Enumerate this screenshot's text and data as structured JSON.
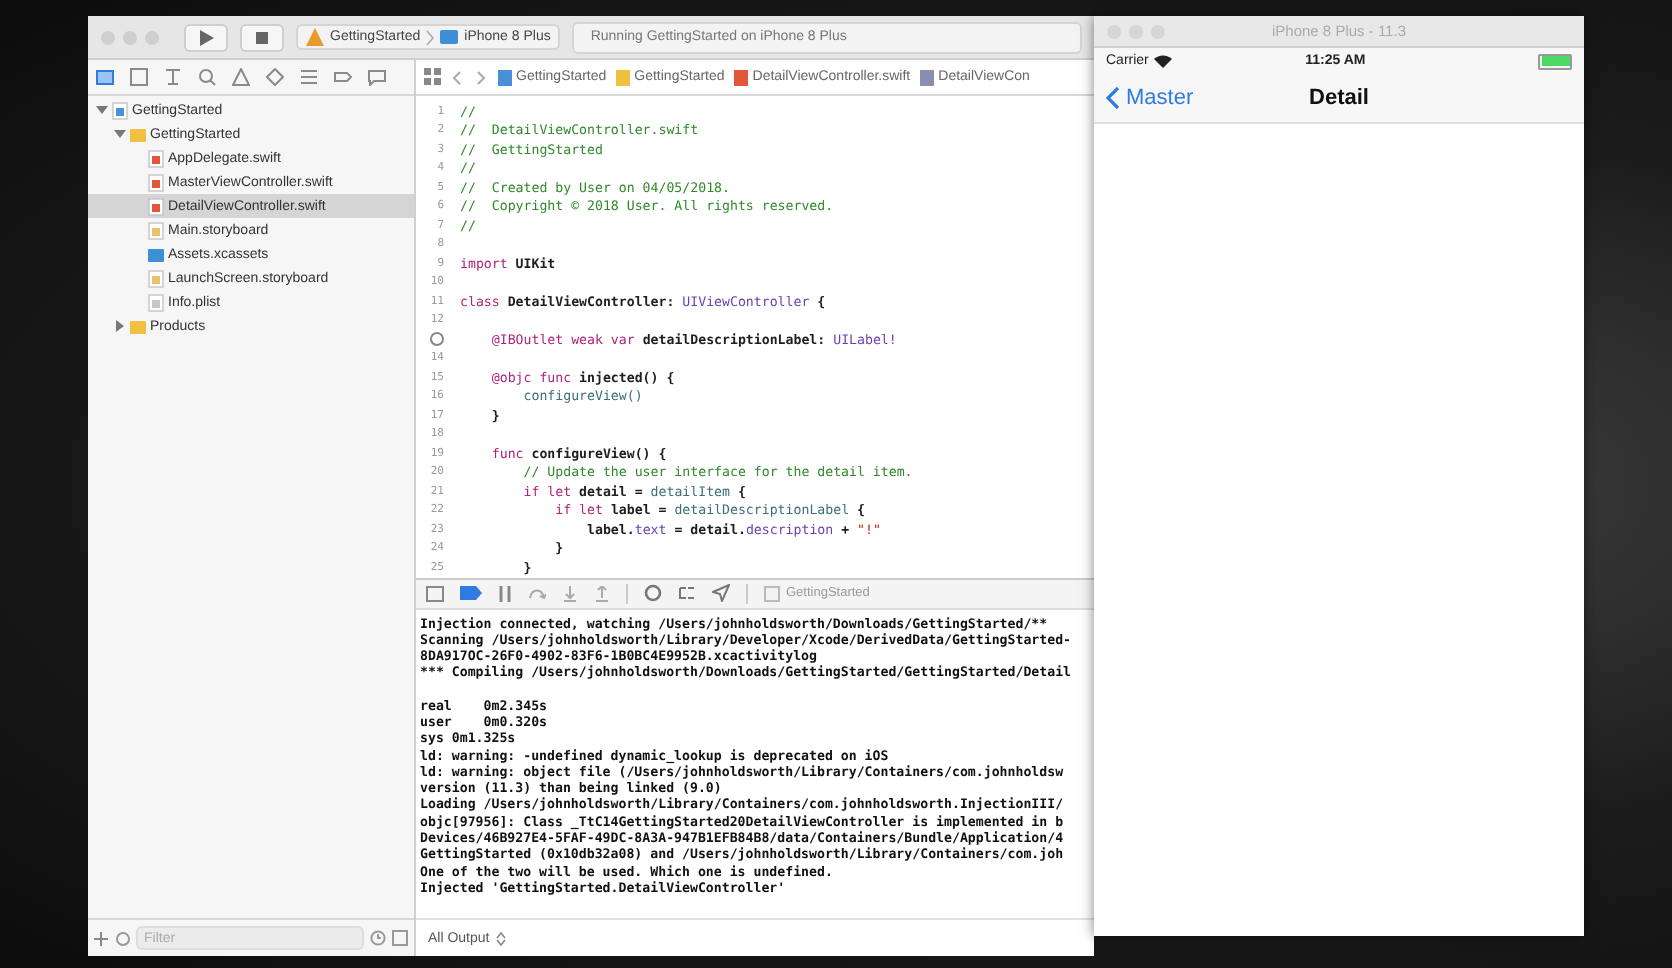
{
  "xcode": {
    "toolbar": {
      "scheme": "GettingStarted",
      "device": "iPhone 8 Plus",
      "activity": "Running GettingStarted on iPhone 8 Plus"
    },
    "navigator_tabs": [
      {
        "kind": "folder",
        "selected": true
      },
      {
        "kind": "box",
        "selected": false
      },
      {
        "kind": "hierarchy",
        "selected": false
      },
      {
        "kind": "search",
        "selected": false
      },
      {
        "kind": "warning",
        "selected": false
      },
      {
        "kind": "diamond",
        "selected": false
      },
      {
        "kind": "list",
        "selected": false
      },
      {
        "kind": "tag",
        "selected": false
      },
      {
        "kind": "bubble",
        "selected": false
      }
    ],
    "tree": [
      {
        "label": "GettingStarted",
        "kind": "project",
        "expanded": true,
        "selected": false,
        "children": [
          {
            "label": "GettingStarted",
            "kind": "folder",
            "expanded": true,
            "selected": false,
            "children": [
              {
                "label": "AppDelegate.swift",
                "kind": "swift",
                "selected": false
              },
              {
                "label": "MasterViewController.swift",
                "kind": "swift",
                "selected": false
              },
              {
                "label": "DetailViewController.swift",
                "kind": "swift",
                "selected": true
              },
              {
                "label": "Main.storyboard",
                "kind": "storyboard",
                "selected": false
              },
              {
                "label": "Assets.xcassets",
                "kind": "assets",
                "selected": false
              },
              {
                "label": "LaunchScreen.storyboard",
                "kind": "storyboard",
                "selected": false
              },
              {
                "label": "Info.plist",
                "kind": "plist",
                "selected": false
              }
            ]
          },
          {
            "label": "Products",
            "kind": "folder",
            "expanded": false,
            "selected": false
          }
        ]
      }
    ],
    "filter": {
      "placeholder": "Filter"
    },
    "jump_bar": [
      {
        "label": "GettingStarted",
        "kind": "project"
      },
      {
        "label": "GettingStarted",
        "kind": "folder"
      },
      {
        "label": "DetailViewController.swift",
        "kind": "swift"
      },
      {
        "label": "DetailViewCon",
        "kind": "class"
      }
    ],
    "code": [
      {
        "n": "1",
        "tokens": [
          {
            "t": "//",
            "kind": "comment"
          }
        ]
      },
      {
        "n": "2",
        "tokens": [
          {
            "t": "//  DetailViewController.swift",
            "kind": "comment"
          }
        ]
      },
      {
        "n": "3",
        "tokens": [
          {
            "t": "//  GettingStarted",
            "kind": "comment"
          }
        ]
      },
      {
        "n": "4",
        "tokens": [
          {
            "t": "//",
            "kind": "comment"
          }
        ]
      },
      {
        "n": "5",
        "tokens": [
          {
            "t": "//  Created by User on 04/05/2018.",
            "kind": "comment"
          }
        ]
      },
      {
        "n": "6",
        "tokens": [
          {
            "t": "//  Copyright © 2018 User. All rights reserved.",
            "kind": "comment"
          }
        ]
      },
      {
        "n": "7",
        "tokens": [
          {
            "t": "//",
            "kind": "comment"
          }
        ]
      },
      {
        "n": "8"
      },
      {
        "n": "9",
        "tokens": [
          {
            "t": "import",
            "kind": "keyword"
          },
          {
            "t": " UIKit",
            "kind": "plain"
          }
        ]
      },
      {
        "n": "10"
      },
      {
        "n": "11",
        "tokens": [
          {
            "t": "class",
            "kind": "keyword"
          },
          {
            "t": " DetailViewController: ",
            "kind": "plain"
          },
          {
            "t": "UIViewController",
            "kind": "type"
          },
          {
            "t": " {",
            "kind": "plain"
          }
        ]
      },
      {
        "n": "12"
      },
      {
        "marker": true,
        "tokens": [
          {
            "t": "    @IBOutlet weak var",
            "kind": "keyword"
          },
          {
            "t": " detailDescriptionLabel: ",
            "kind": "plain"
          },
          {
            "t": "UILabel!",
            "kind": "type"
          }
        ]
      },
      {
        "n": "14"
      },
      {
        "n": "15",
        "tokens": [
          {
            "t": "    @objc func",
            "kind": "keyword"
          },
          {
            "t": " injected() {",
            "kind": "plain"
          }
        ]
      },
      {
        "n": "16",
        "tokens": [
          {
            "t": "        configureView()",
            "kind": "variable"
          }
        ]
      },
      {
        "n": "17",
        "tokens": [
          {
            "t": "    }",
            "kind": "plain"
          }
        ]
      },
      {
        "n": "18"
      },
      {
        "n": "19",
        "tokens": [
          {
            "t": "    func",
            "kind": "keyword"
          },
          {
            "t": " configureView() {",
            "kind": "plain"
          }
        ]
      },
      {
        "n": "20",
        "tokens": [
          {
            "t": "        // Update the user interface for the detail item.",
            "kind": "comment"
          }
        ]
      },
      {
        "n": "21",
        "tokens": [
          {
            "t": "        if let",
            "kind": "keyword"
          },
          {
            "t": " detail = ",
            "kind": "plain"
          },
          {
            "t": "detailItem",
            "kind": "variable"
          },
          {
            "t": " {",
            "kind": "plain"
          }
        ]
      },
      {
        "n": "22",
        "tokens": [
          {
            "t": "            if let",
            "kind": "keyword"
          },
          {
            "t": " label = ",
            "kind": "plain"
          },
          {
            "t": "detailDescriptionLabel",
            "kind": "variable"
          },
          {
            "t": " {",
            "kind": "plain"
          }
        ]
      },
      {
        "n": "23",
        "tokens": [
          {
            "t": "                label.",
            "kind": "plain"
          },
          {
            "t": "text",
            "kind": "type"
          },
          {
            "t": " = detail.",
            "kind": "plain"
          },
          {
            "t": "description",
            "kind": "type"
          },
          {
            "t": " + ",
            "kind": "plain"
          },
          {
            "t": "\"!\"",
            "kind": "string"
          }
        ]
      },
      {
        "n": "24",
        "tokens": [
          {
            "t": "            }",
            "kind": "plain"
          }
        ]
      },
      {
        "n": "25",
        "tokens": [
          {
            "t": "        }",
            "kind": "plain"
          }
        ]
      }
    ],
    "debug_bar": {
      "breakpoints_active": true,
      "target": "GettingStarted"
    },
    "console": [
      [
        "Injection connected, watching /Users/johnholdsworth/Downloads/GettingStarted/**",
        "Scanning /Users/johnholdsworth/Library/Developer/Xcode/DerivedData/GettingStarted-",
        "8DA917OC-26F0-4902-83F6-1B0BC4E9952B.xcactivitylog",
        "*** Compiling /Users/johnholdsworth/Downloads/GettingStarted/GettingStarted/Detail"
      ],
      [
        "real    0m2.345s",
        "user    0m0.320s",
        "sys 0m1.325s",
        "ld: warning: -undefined dynamic_lookup is deprecated on iOS",
        "ld: warning: object file (/Users/johnholdsworth/Library/Containers/com.johnholdsw",
        "version (11.3) than being linked (9.0)",
        "Loading /Users/johnholdsworth/Library/Containers/com.johnholdsworth.InjectionIII/",
        "objc[97956]: Class _TtC14GettingStarted20DetailViewController is implemented in b",
        "Devices/46B927E4-5FAF-49DC-8A3A-947B1EFB84B8/data/Containers/Bundle/Application/4",
        "GettingStarted (0x10db32a08) and /Users/johnholdsworth/Library/Containers/com.joh",
        "One of the two will be used. Which one is undefined.",
        "Injected 'GettingStarted.DetailViewController'"
      ]
    ],
    "output_filter": "All Output"
  },
  "simulator": {
    "title": "iPhone 8 Plus - 11.3",
    "carrier": "Carrier",
    "time": "11:25 AM",
    "battery": {
      "level": 1
    },
    "back": "Master",
    "nav_title": "Detail"
  }
}
